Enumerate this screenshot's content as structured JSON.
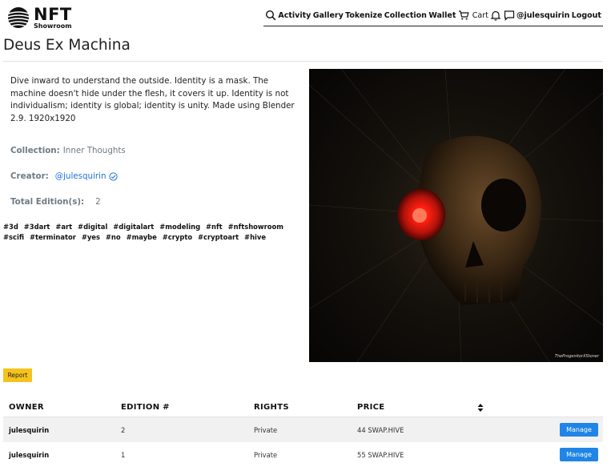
{
  "brand": {
    "name": "NFT",
    "sub": "Showroom"
  },
  "nav": {
    "activity": "Activity",
    "gallery": "Gallery",
    "tokenize": "Tokenize",
    "collection": "Collection",
    "wallet": "Wallet",
    "cart": "Cart",
    "user": "@julesquirin",
    "logout": "Logout"
  },
  "page": {
    "title": "Deus Ex Machina"
  },
  "description": "Dive inward to understand the outside. Identity is a mask. The machine doesn't hide under the flesh, it covers it up. Identity is not individualism; identity is global; identity is unity. Made using Blender 2.9. 1920x1920",
  "meta": {
    "collection_label": "Collection:",
    "collection_value": "Inner Thoughts",
    "creator_label": "Creator:",
    "creator_value": "@julesquirin",
    "editions_label": "Total Edition(s):",
    "editions_value": "2"
  },
  "tags": [
    "#3d",
    "#3dart",
    "#art",
    "#digital",
    "#digitalart",
    "#modeling",
    "#nft",
    "#nftshowroom",
    "#scifi",
    "#terminator",
    "#yes",
    "#no",
    "#maybe",
    "#crypto",
    "#cryptoart",
    "#hive"
  ],
  "artwork": {
    "watermark": "TheProgenitorXStoner"
  },
  "report_label": "Report",
  "table": {
    "headers": {
      "owner": "OWNER",
      "edition": "EDITION #",
      "rights": "RIGHTS",
      "price": "PRICE"
    },
    "rows": [
      {
        "owner": "julesquirin",
        "edition": "2",
        "rights": "Private",
        "price": "44 SWAP.HIVE",
        "action": "Manage"
      },
      {
        "owner": "julesquirin",
        "edition": "1",
        "rights": "Private",
        "price": "55 SWAP.HIVE",
        "action": "Manage"
      }
    ]
  },
  "colors": {
    "accent": "#1f85e6",
    "report": "#f6c21c",
    "link": "#1f73d6"
  }
}
